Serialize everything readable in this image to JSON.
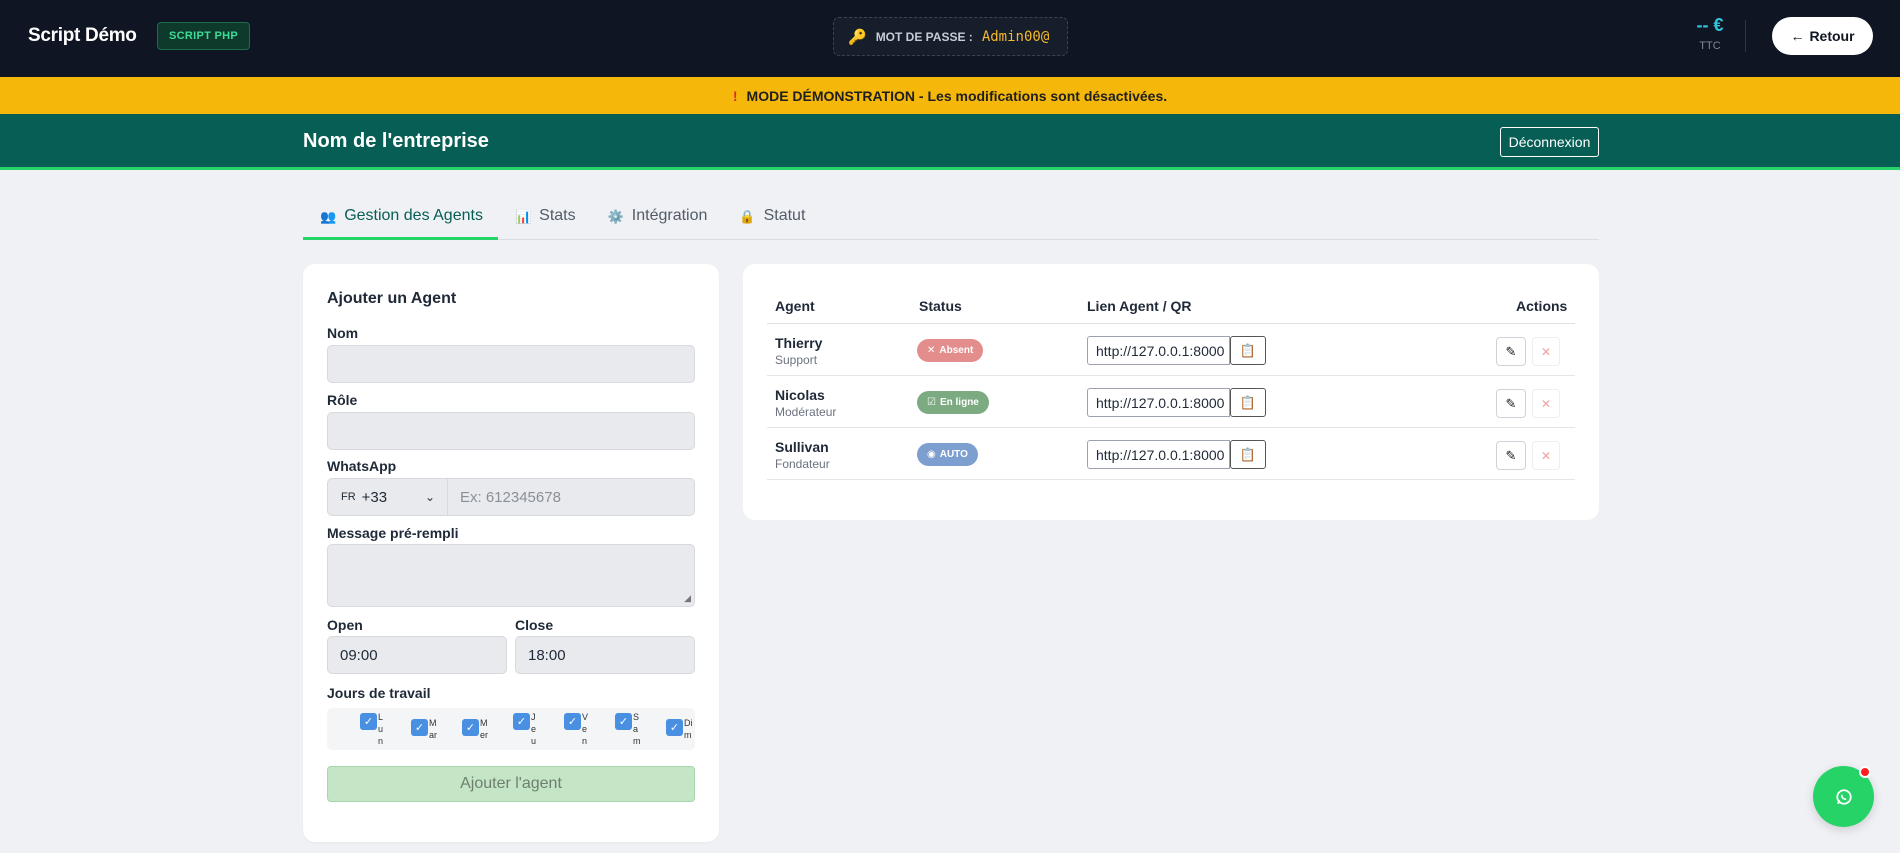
{
  "topbar": {
    "brand": "Script Démo",
    "badge": "SCRIPT PHP",
    "password_label": "MOT DE PASSE :",
    "password_value": "Admin00@",
    "price": "-- €",
    "price_note": "TTC",
    "back_button": "Retour"
  },
  "banner": {
    "text": "MODE DÉMONSTRATION - Les modifications sont désactivées."
  },
  "company": {
    "name": "Nom de l'entreprise",
    "logout": "Déconnexion"
  },
  "tabs": [
    {
      "label": "Gestion des Agents",
      "icon": "users-icon",
      "active": true
    },
    {
      "label": "Stats",
      "icon": "chart-icon",
      "active": false
    },
    {
      "label": "Intégration",
      "icon": "gear-icon",
      "active": false
    },
    {
      "label": "Statut",
      "icon": "lock-icon",
      "active": false
    }
  ],
  "form": {
    "title": "Ajouter un Agent",
    "name_label": "Nom",
    "role_label": "Rôle",
    "whatsapp_label": "WhatsApp",
    "country_code": "FR",
    "country_dial": "+33",
    "phone_placeholder": "Ex: 612345678",
    "message_label": "Message pré-rempli",
    "open_label": "Open",
    "open_value": "09:00",
    "close_label": "Close",
    "close_value": "18:00",
    "days_label": "Jours de travail",
    "days": [
      "Lun",
      "Mar",
      "Mer",
      "Jeu",
      "Ven",
      "Sam",
      "Dim"
    ],
    "submit": "Ajouter l'agent"
  },
  "table": {
    "headers": {
      "agent": "Agent",
      "status": "Status",
      "link": "Lien Agent / QR",
      "actions": "Actions"
    },
    "rows": [
      {
        "name": "Thierry",
        "role": "Support",
        "status": "Absent",
        "status_icon": "✕",
        "link": "http://127.0.0.1:8000"
      },
      {
        "name": "Nicolas",
        "role": "Modérateur",
        "status": "En ligne",
        "status_icon": "☑",
        "link": "http://127.0.0.1:8000"
      },
      {
        "name": "Sullivan",
        "role": "Fondateur",
        "status": "AUTO",
        "status_icon": "◉",
        "link": "http://127.0.0.1:8000"
      }
    ]
  },
  "colors": {
    "topbar": "#0f1522",
    "banner": "#f5b80a",
    "brand_green": "#075e54",
    "accent_green": "#25d366"
  }
}
